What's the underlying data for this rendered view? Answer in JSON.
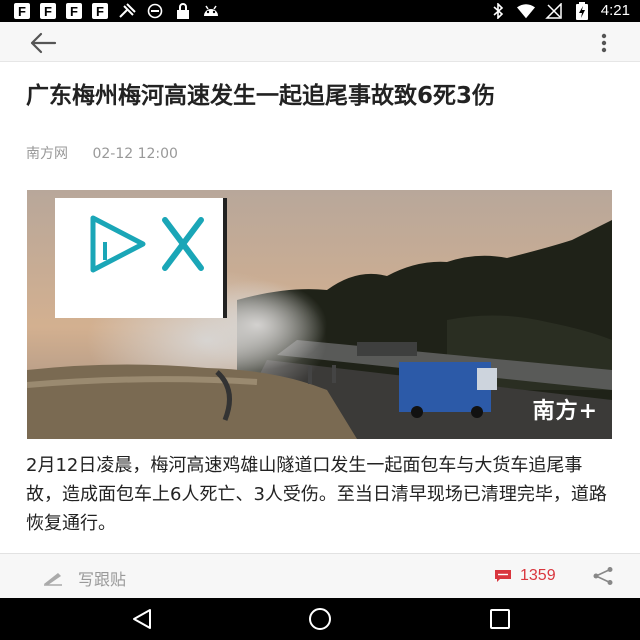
{
  "status_bar": {
    "fb_labels": [
      "F",
      "F",
      "F",
      "F"
    ],
    "time": "4:21"
  },
  "top_bar": {
    "back_icon": "arrow-left-icon",
    "more_icon": "more-vertical-icon"
  },
  "article": {
    "title": "广东梅州梅河高速发生一起追尾事故致6死3伤",
    "source": "南方网",
    "datetime": "02-12 12:00",
    "photo_watermark": "南方+",
    "body": "2月12日凌晨，梅河高速鸡雄山隧道口发生一起面包车与大货车追尾事故，造成面包车上6人死亡、3人受伤。至当日清早现场已清理完毕，道路恢复通行。"
  },
  "bottom_bar": {
    "reply_placeholder": "写跟贴",
    "comment_count": "1359",
    "accent_color": "#d9363e"
  }
}
